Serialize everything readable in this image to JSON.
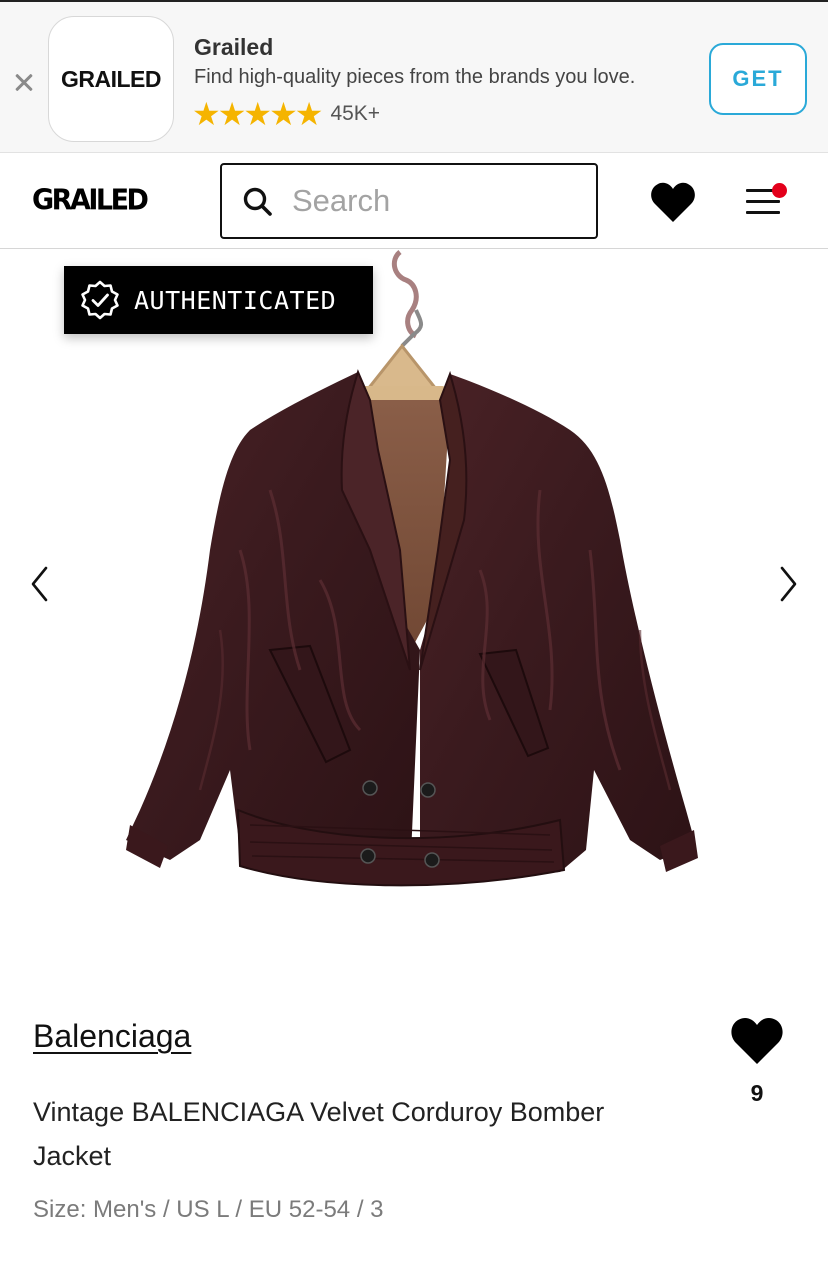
{
  "app_banner": {
    "icon_text": "GRAILED",
    "name": "Grailed",
    "description": "Find high-quality pieces from the brands you love.",
    "stars": "★★★★★",
    "rating_count": "45K+",
    "get_label": "GET",
    "accent_color": "#2aa9d8",
    "star_color": "#f5b400",
    "close_icon": "close-icon"
  },
  "header": {
    "logo": "GRAILED",
    "search_placeholder": "Search",
    "icons": [
      "search-icon",
      "heart-icon",
      "menu-icon"
    ],
    "notification_color": "#e3001b"
  },
  "gallery": {
    "badge_label": "AUTHENTICATED",
    "badge_icon": "verified-check-icon",
    "prev_icon": "chevron-left-icon",
    "next_icon": "chevron-right-icon",
    "image_alt": "burgundy velvet bomber jacket on hanger"
  },
  "product": {
    "brand": "Balenciaga",
    "title": "Vintage BALENCIAGA Velvet Corduroy Bomber Jacket",
    "size": "Size: Men's / US L / EU 52-54 / 3",
    "favorite_count": "9"
  }
}
